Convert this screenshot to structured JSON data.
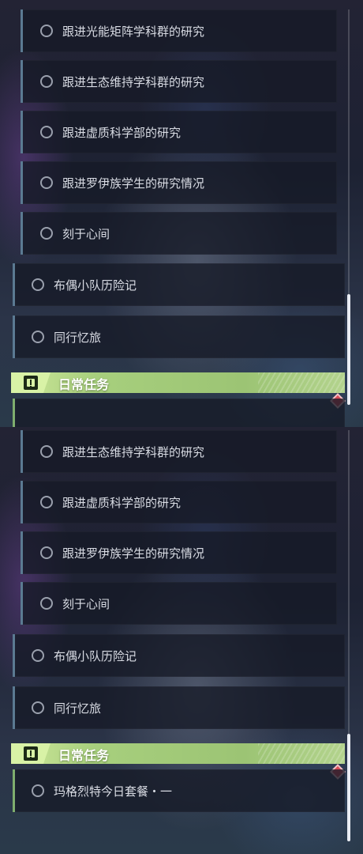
{
  "top_panel": {
    "quests": [
      {
        "label": "跟进光能矩阵学科群的研究"
      },
      {
        "label": "跟进生态维持学科群的研究"
      },
      {
        "label": "跟进虚质科学部的研究"
      },
      {
        "label": "跟进罗伊族学生的研究情况"
      },
      {
        "label": "刻于心间"
      },
      {
        "label": "布偶小队历险记"
      },
      {
        "label": "同行忆旅"
      }
    ],
    "daily_header": {
      "title": "日常任务"
    }
  },
  "bottom_panel": {
    "quests": [
      {
        "label": "跟进生态维持学科群的研究"
      },
      {
        "label": "跟进虚质科学部的研究"
      },
      {
        "label": "跟进罗伊族学生的研究情况"
      },
      {
        "label": "刻于心间"
      },
      {
        "label": "布偶小队历险记"
      },
      {
        "label": "同行忆旅"
      }
    ],
    "daily_header": {
      "title": "日常任务"
    },
    "daily_quests": [
      {
        "label": "玛格烈特今日套餐・一"
      }
    ]
  },
  "colors": {
    "quest_accent": "#5b7a92",
    "daily_accent": "#a7cf7d",
    "alert_marker": "#d94b57"
  },
  "icons": {
    "quest_status": "empty-circle-icon",
    "daily_header": "exclamation-box-icon",
    "alert": "red-diamond-icon"
  }
}
